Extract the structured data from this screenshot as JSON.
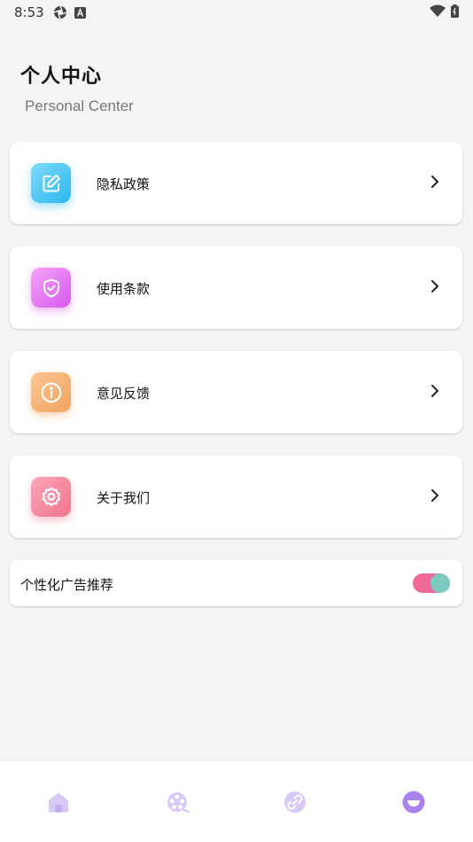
{
  "status_bar": {
    "time": "8:53",
    "icons_left": [
      "aperture-icon",
      "a-letter-icon"
    ],
    "icons_right": [
      "wifi-icon",
      "battery-icon"
    ]
  },
  "header": {
    "title": "个人中心",
    "subtitle": "Personal Center"
  },
  "menu": [
    {
      "label": "隐私政策",
      "icon": "edit-icon",
      "color": "#2bb6f0"
    },
    {
      "label": "使用条款",
      "icon": "shield-check-icon",
      "color": "#d859ef"
    },
    {
      "label": "意见反馈",
      "icon": "info-icon",
      "color": "#f0a25e"
    },
    {
      "label": "关于我们",
      "icon": "gear-icon",
      "color": "#f1738e"
    }
  ],
  "toggle": {
    "label": "个性化广告推荐",
    "on": true,
    "track_color": "#f06a98",
    "knob_color": "#7cc9bf"
  },
  "bottom_nav": [
    {
      "icon": "home-icon",
      "active": false
    },
    {
      "icon": "film-reel-icon",
      "active": false
    },
    {
      "icon": "link-icon",
      "active": false
    },
    {
      "icon": "smile-icon",
      "active": true
    }
  ],
  "colors": {
    "nav_inactive": "#d7c8f6",
    "nav_active": "#a982ec"
  }
}
